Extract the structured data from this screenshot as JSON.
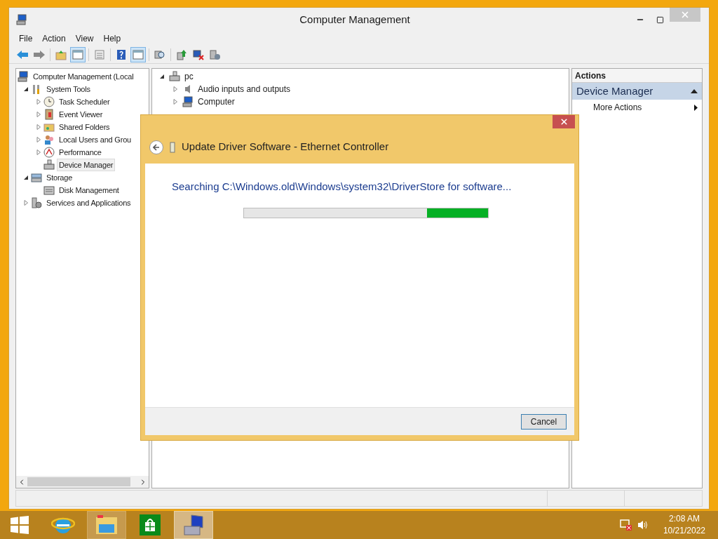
{
  "window": {
    "title": "Computer Management"
  },
  "menu": [
    "File",
    "Action",
    "View",
    "Help"
  ],
  "toolbar": [
    {
      "pressed": false
    },
    {
      "pressed": false
    },
    {
      "pressed": false
    },
    {
      "pressed": true
    },
    {
      "pressed": false
    },
    {
      "pressed": false
    },
    {
      "pressed": true
    },
    {
      "pressed": false
    },
    {
      "pressed": false
    },
    {
      "pressed": false
    },
    {
      "pressed": false
    }
  ],
  "tree": [
    {
      "label": "Computer Management (Local",
      "selected": false,
      "children": [
        {
          "label": "System Tools",
          "expanded": true,
          "selected": false,
          "children": [
            {
              "label": "Task Scheduler",
              "expanded": false,
              "selected": false
            },
            {
              "label": "Event Viewer",
              "expanded": false,
              "selected": false
            },
            {
              "label": "Shared Folders",
              "expanded": false,
              "selected": false
            },
            {
              "label": "Local Users and Grou",
              "expanded": false,
              "selected": false
            },
            {
              "label": "Performance",
              "expanded": false,
              "selected": false
            },
            {
              "label": "Device Manager",
              "selected": true
            }
          ]
        },
        {
          "label": "Storage",
          "expanded": true,
          "selected": false,
          "children": [
            {
              "label": "Disk Management",
              "selected": false
            }
          ]
        },
        {
          "label": "Services and Applications",
          "expanded": false,
          "selected": false
        }
      ]
    }
  ],
  "devices": {
    "root": {
      "label": "pc",
      "expanded": true
    },
    "items": [
      {
        "label": "Audio inputs and outputs",
        "expanded": false
      },
      {
        "label": "Computer",
        "expanded": false
      }
    ]
  },
  "actions": {
    "header": "Actions",
    "section": "Device Manager",
    "items": [
      "More Actions"
    ]
  },
  "dialog": {
    "title": "Update Driver Software - Ethernet Controller",
    "message": "Searching C:\\Windows.old\\Windows\\system32\\DriverStore for software...",
    "progress": {
      "level": 0.25
    },
    "buttons": [
      "Cancel"
    ]
  },
  "taskbar": {
    "apps": [
      {
        "selected": false
      },
      {
        "selected": false
      },
      {
        "selected": false
      },
      {
        "selected": false
      },
      {
        "selected": true
      }
    ],
    "time": "2:08 AM",
    "date": "10/21/2022"
  }
}
